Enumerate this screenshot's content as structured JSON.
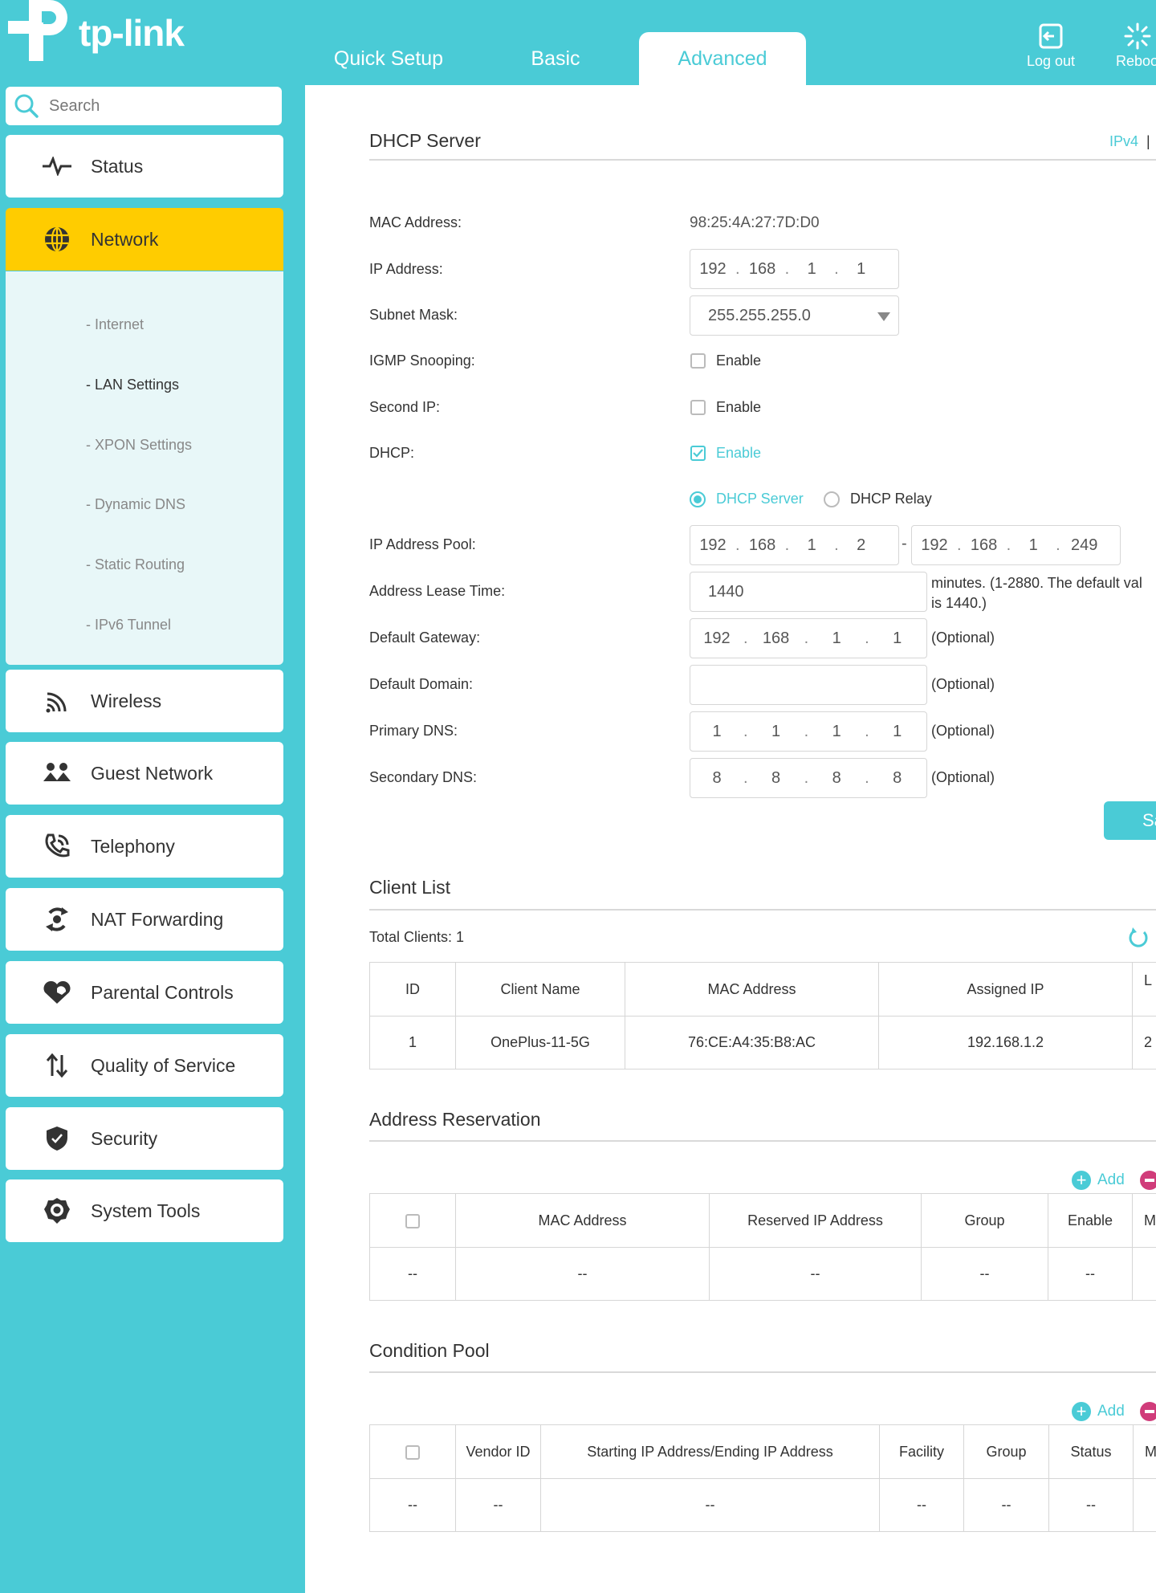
{
  "brand": {
    "name": "tp-link"
  },
  "tabs": [
    {
      "label": "Quick Setup"
    },
    {
      "label": "Basic"
    },
    {
      "label": "Advanced"
    }
  ],
  "header_actions": {
    "logout": "Log out",
    "reboot": "Reboo"
  },
  "search": {
    "placeholder": "Search"
  },
  "nav": [
    {
      "label": "Status",
      "icon": "pulse-icon"
    },
    {
      "label": "Network",
      "icon": "globe-icon"
    },
    {
      "label": "Wireless",
      "icon": "wifi-icon"
    },
    {
      "label": "Guest Network",
      "icon": "guests-icon"
    },
    {
      "label": "Telephony",
      "icon": "phone-icon"
    },
    {
      "label": "NAT Forwarding",
      "icon": "nat-icon"
    },
    {
      "label": "Parental Controls",
      "icon": "heart-icon"
    },
    {
      "label": "Quality of Service",
      "icon": "qos-arrows-icon"
    },
    {
      "label": "Security",
      "icon": "shield-icon"
    },
    {
      "label": "System Tools",
      "icon": "gear-icon"
    }
  ],
  "subnav": [
    {
      "label": "- Internet"
    },
    {
      "label": "- LAN Settings"
    },
    {
      "label": "- XPON Settings"
    },
    {
      "label": "- Dynamic DNS"
    },
    {
      "label": "- Static Routing"
    },
    {
      "label": "- IPv6 Tunnel"
    }
  ],
  "dhcp": {
    "title": "DHCP Server",
    "ipv4_link": "IPv4",
    "ipv4_sep": "|",
    "labels": {
      "mac": "MAC Address:",
      "ip": "IP Address:",
      "subnet": "Subnet Mask:",
      "igmp": "IGMP Snooping:",
      "second_ip": "Second IP:",
      "dhcp": "DHCP:",
      "pool": "IP Address Pool:",
      "lease": "Address Lease Time:",
      "gateway": "Default Gateway:",
      "domain": "Default Domain:",
      "dns1": "Primary DNS:",
      "dns2": "Secondary DNS:"
    },
    "mac_value": "98:25:4A:27:7D:D0",
    "ip": [
      "192",
      "168",
      "1",
      "1"
    ],
    "subnet_value": "255.255.255.0",
    "enable_label": "Enable",
    "radio_server": "DHCP Server",
    "radio_relay": "DHCP Relay",
    "pool_start": [
      "192",
      "168",
      "1",
      "2"
    ],
    "pool_dash": "-",
    "pool_end": [
      "192",
      "168",
      "1",
      "249"
    ],
    "lease_value": "1440",
    "lease_note_1": "minutes. (1-2880. The default val",
    "lease_note_2": "is 1440.)",
    "gateway": [
      "192",
      "168",
      "1",
      "1"
    ],
    "domain_value": "",
    "dns1": [
      "1",
      "1",
      "1",
      "1"
    ],
    "dns2": [
      "8",
      "8",
      "8",
      "8"
    ],
    "optional": "(Optional)",
    "save": "Sa"
  },
  "clients": {
    "title": "Client List",
    "total": "Total Clients: 1",
    "headers": [
      "ID",
      "Client Name",
      "MAC Address",
      "Assigned IP",
      "L"
    ],
    "rows": [
      {
        "id": "1",
        "name": "OnePlus-11-5G",
        "mac": "76:CE:A4:35:B8:AC",
        "ip": "192.168.1.2",
        "lease": "2"
      }
    ]
  },
  "reservation": {
    "title": "Address Reservation",
    "add": "Add",
    "headers": [
      "MAC Address",
      "Reserved IP Address",
      "Group",
      "Enable",
      "M"
    ],
    "empty": [
      "--",
      "--",
      "--",
      "--",
      "--"
    ]
  },
  "condition": {
    "title": "Condition Pool",
    "add": "Add",
    "headers": [
      "Vendor ID",
      "Starting IP Address/Ending IP Address",
      "Facility",
      "Group",
      "Status",
      "M"
    ],
    "empty": [
      "--",
      "--",
      "--",
      "--",
      "--",
      "--",
      "--"
    ]
  },
  "colors": {
    "accent": "#4acbd6",
    "active_nav": "#ffcc00",
    "delete": "#d03c7a"
  }
}
